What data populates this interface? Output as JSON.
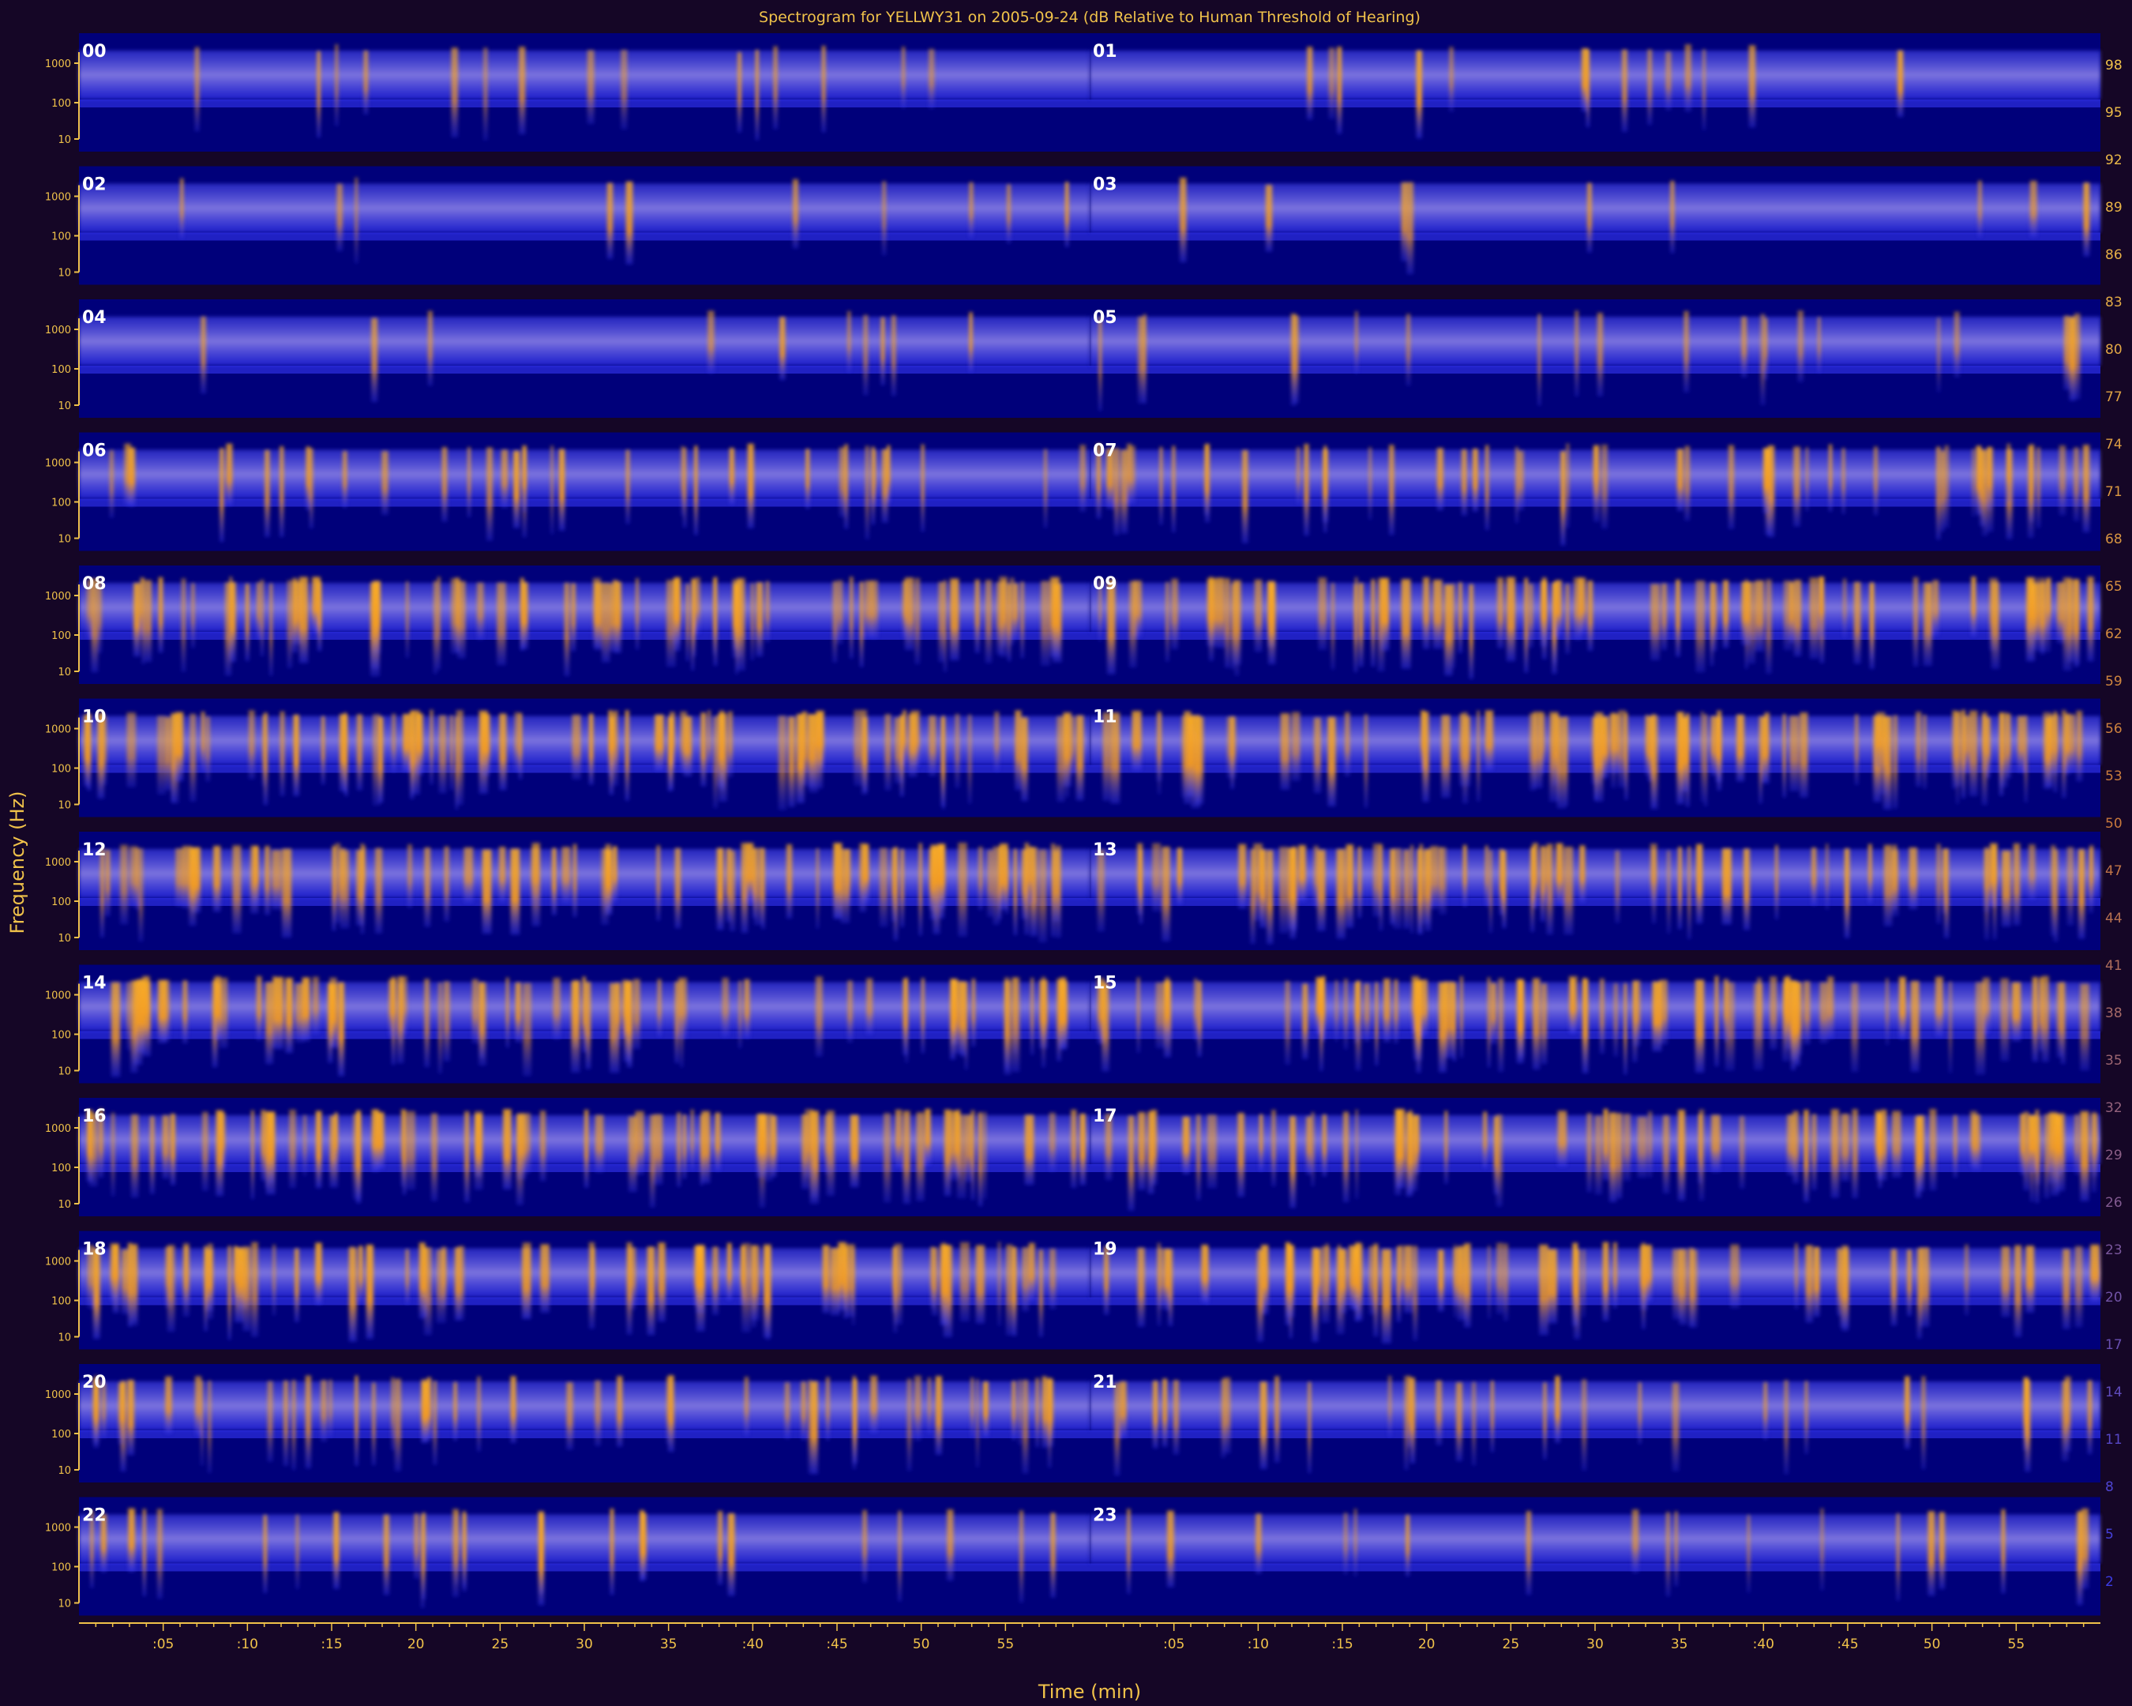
{
  "chart_data": {
    "type": "heatmap",
    "title": "Spectrogram for YELLWY31 on 2005-09-24 (dB Relative to Human Threshold of Hearing)",
    "xlabel": "Time (min)",
    "ylabel": "Frequency (Hz)",
    "x_ticks": [
      ":05",
      ":10",
      ":15",
      "20",
      "25",
      "30",
      "35",
      ":40",
      ":45",
      "50",
      "55"
    ],
    "y_ticks": [
      "1000",
      "100",
      "10"
    ],
    "colorbar_ticks": [
      "98",
      "95",
      "92",
      "89",
      "86",
      "83",
      "80",
      "77",
      "74",
      "71",
      "68",
      "65",
      "62",
      "59",
      "56",
      "53",
      "50",
      "47",
      "44",
      "41",
      "38",
      "35",
      "32",
      "29",
      "26",
      "23",
      "20",
      "17",
      "14",
      "11",
      "8",
      "5",
      "2"
    ],
    "colorbar_range": [
      2,
      98
    ],
    "colors": {
      "background": "#150626",
      "low": "#00007a",
      "mid": "#3a3cff",
      "high": "#ffa500",
      "text": "#f0c24a"
    },
    "hours": [
      {
        "label": "00",
        "activity": 0.12
      },
      {
        "label": "01",
        "activity": 0.1
      },
      {
        "label": "02",
        "activity": 0.06
      },
      {
        "label": "03",
        "activity": 0.05
      },
      {
        "label": "04",
        "activity": 0.06
      },
      {
        "label": "05",
        "activity": 0.18
      },
      {
        "label": "06",
        "activity": 0.35
      },
      {
        "label": "07",
        "activity": 0.55
      },
      {
        "label": "08",
        "activity": 0.85
      },
      {
        "label": "09",
        "activity": 0.88
      },
      {
        "label": "10",
        "activity": 0.92
      },
      {
        "label": "11",
        "activity": 0.9
      },
      {
        "label": "12",
        "activity": 0.86
      },
      {
        "label": "13",
        "activity": 0.82
      },
      {
        "label": "14",
        "activity": 0.8
      },
      {
        "label": "15",
        "activity": 0.84
      },
      {
        "label": "16",
        "activity": 0.8
      },
      {
        "label": "17",
        "activity": 0.78
      },
      {
        "label": "18",
        "activity": 0.8
      },
      {
        "label": "19",
        "activity": 0.72
      },
      {
        "label": "20",
        "activity": 0.55
      },
      {
        "label": "21",
        "activity": 0.3
      },
      {
        "label": "22",
        "activity": 0.25
      },
      {
        "label": "23",
        "activity": 0.15
      }
    ]
  }
}
